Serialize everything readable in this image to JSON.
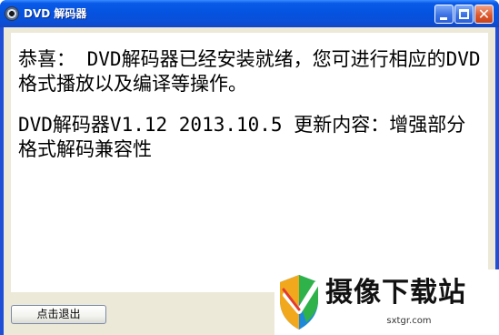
{
  "window": {
    "title": "DVD 解码器",
    "app_icon": "disc-icon"
  },
  "titlebar_buttons": {
    "minimize": "minimize-icon",
    "maximize": "maximize-icon",
    "close": "close-icon",
    "close_glyph": "✕"
  },
  "content": {
    "message_install": "恭喜： DVD解码器已经安装就绪，您可进行相应的DVD格式播放以及编译等操作。",
    "message_update": "DVD解码器V1.12 2013.10.5 更新内容：增强部分格式解码兼容性"
  },
  "footer": {
    "exit_label": "点击退出"
  },
  "watermark": {
    "name": "摄像下载站",
    "url": "sxtgr.com"
  },
  "colors": {
    "titlebar": "#0553e0",
    "client_bg": "#ece9d8",
    "content_bg": "#ffffff",
    "close_button": "#dd5a30"
  }
}
